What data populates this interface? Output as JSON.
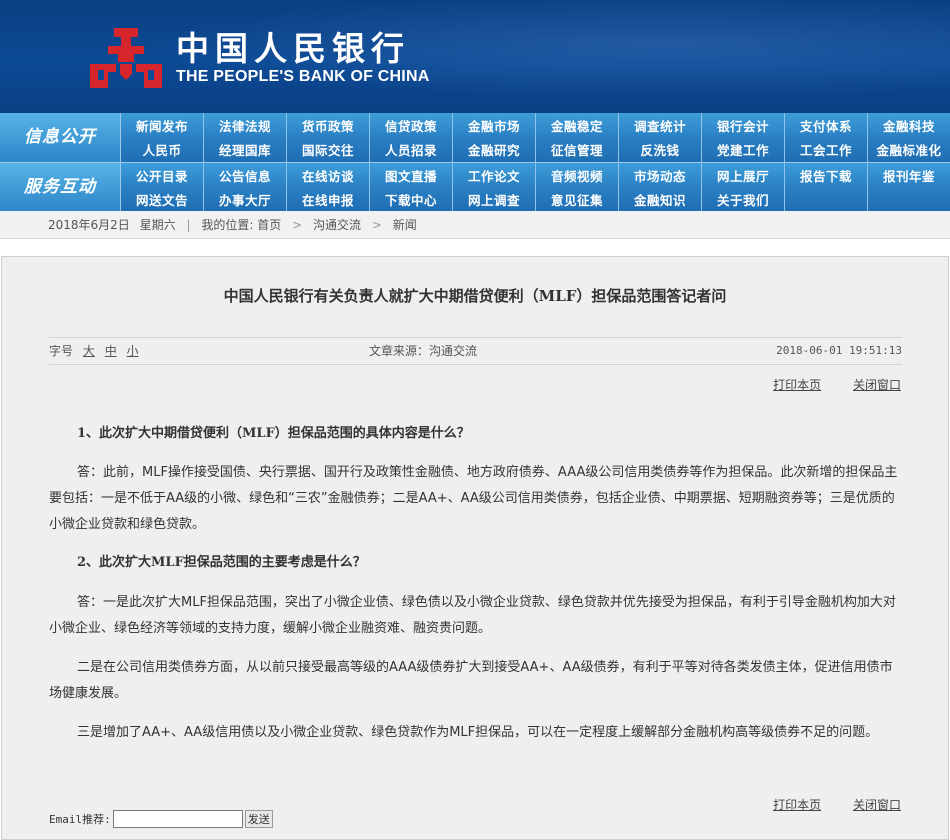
{
  "header": {
    "logo_cn": "中国人民银行",
    "logo_en": "THE PEOPLE'S BANK OF CHINA",
    "emblem_icon": "pboc-emblem-icon",
    "brand_color": "#0b4490",
    "emblem_color": "#d7262b"
  },
  "nav": {
    "sections": [
      {
        "heading": "信息公开",
        "rows": [
          [
            "新闻发布",
            "法律法规",
            "货币政策",
            "信贷政策",
            "金融市场",
            "金融稳定",
            "调查统计",
            "银行会计",
            "支付体系",
            "金融科技"
          ],
          [
            "人民币",
            "经理国库",
            "国际交往",
            "人员招录",
            "金融研究",
            "征信管理",
            "反洗钱",
            "党建工作",
            "工会工作",
            "金融标准化"
          ]
        ]
      },
      {
        "heading": "服务互动",
        "rows": [
          [
            "公开目录",
            "公告信息",
            "在线访谈",
            "图文直播",
            "工作论文",
            "音频视频",
            "市场动态",
            "网上展厅",
            "报告下载",
            "报刊年鉴"
          ],
          [
            "网送文告",
            "办事大厅",
            "在线申报",
            "下载中心",
            "网上调查",
            "意见征集",
            "金融知识",
            "关于我们",
            "",
            ""
          ]
        ]
      }
    ]
  },
  "breadcrumb": {
    "date": "2018年6月2日",
    "weekday": "星期六",
    "location_label": "我的位置:",
    "home": "首页",
    "section": "沟通交流",
    "current": "新闻"
  },
  "article": {
    "title": "中国人民银行有关负责人就扩大中期借贷便利（MLF）担保品范围答记者问",
    "font_size_label": "字号",
    "font_sizes": [
      "大",
      "中",
      "小"
    ],
    "source": "文章来源：沟通交流",
    "datetime": "2018-06-01 19:51:13",
    "print_label": "打印本页",
    "close_label": "关闭窗口",
    "q1": "1、此次扩大中期借贷便利（MLF）担保品范围的具体内容是什么？",
    "a1": "答：此前，MLF操作接受国债、央行票据、国开行及政策性金融债、地方政府债券、AAA级公司信用类债券等作为担保品。此次新增的担保品主要包括：一是不低于AA级的小微、绿色和“三农”金融债券；二是AA+、AA级公司信用类债券，包括企业债、中期票据、短期融资券等；三是优质的小微企业贷款和绿色贷款。",
    "q2": "2、此次扩大MLF担保品范围的主要考虑是什么？",
    "a2_1": "答：一是此次扩大MLF担保品范围，突出了小微企业债、绿色债以及小微企业贷款、绿色贷款并优先接受为担保品，有利于引导金融机构加大对小微企业、绿色经济等领域的支持力度，缓解小微企业融资难、融资贵问题。",
    "a2_2": "二是在公司信用类债券方面，从以前只接受最高等级的AAA级债券扩大到接受AA+、AA级债券，有利于平等对待各类发债主体，促进信用债市场健康发展。",
    "a2_3": "三是增加了AA+、AA级信用债以及小微企业贷款、绿色贷款作为MLF担保品，可以在一定程度上缓解部分金融机构高等级债券不足的问题。"
  },
  "email": {
    "label": "Email推荐:",
    "value": "",
    "send_label": "发送"
  }
}
